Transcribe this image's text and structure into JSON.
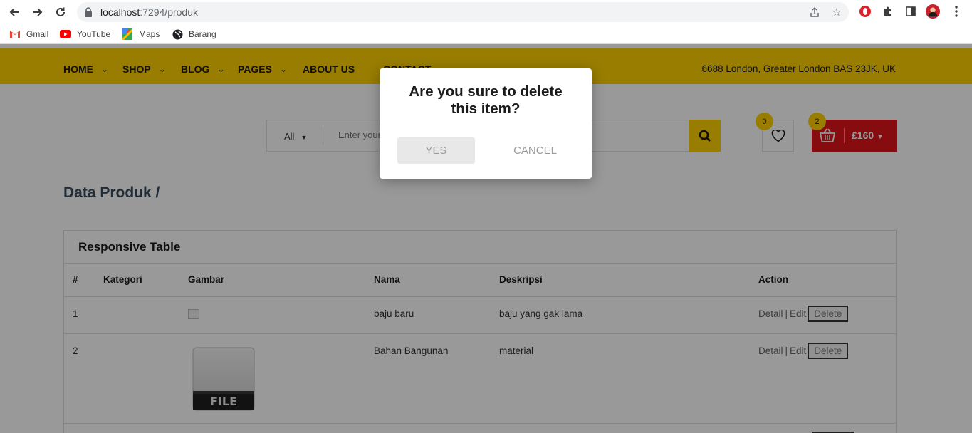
{
  "browser": {
    "url_host": "localhost",
    "url_path": ":7294/produk",
    "bookmarks": [
      {
        "label": "Gmail",
        "icon": "gmail-icon"
      },
      {
        "label": "YouTube",
        "icon": "youtube-icon"
      },
      {
        "label": "Maps",
        "icon": "maps-icon"
      },
      {
        "label": "Barang",
        "icon": "globe-icon"
      }
    ]
  },
  "header": {
    "menu": [
      {
        "label": "HOME",
        "has_dropdown": true
      },
      {
        "label": "SHOP",
        "has_dropdown": true
      },
      {
        "label": "BLOG",
        "has_dropdown": true
      },
      {
        "label": "PAGES",
        "has_dropdown": true
      },
      {
        "label": "ABOUT US",
        "has_dropdown": false
      },
      {
        "label": "CONTACT",
        "has_dropdown": false
      }
    ],
    "address": "6688 London, Greater London BAS 23JK, UK",
    "accent_color": "#fdd100"
  },
  "search": {
    "category": "All",
    "placeholder": "Enter your keyword..."
  },
  "wishlist": {
    "count": "0"
  },
  "cart": {
    "count": "2",
    "total": "£160",
    "color": "#e1141b"
  },
  "page": {
    "title": "Data Produk /"
  },
  "table": {
    "title": "Responsive Table",
    "columns": [
      "#",
      "Kategori",
      "Gambar",
      "Nama",
      "Deskripsi",
      "Action"
    ],
    "rows": [
      {
        "no": "1",
        "kategori": "",
        "nama": "baju baru",
        "deskripsi": "baju yang gak lama",
        "image": "broken-image-icon"
      },
      {
        "no": "2",
        "kategori": "",
        "nama": "Bahan Bangunan",
        "deskripsi": "material",
        "image": "file-icon",
        "image_text": "FILE"
      }
    ],
    "actions": {
      "detail": "Detail",
      "sep": "|",
      "edit": "Edit",
      "delete": "Delete"
    }
  },
  "dialog": {
    "title": "Are you sure to delete this item?",
    "yes": "YES",
    "cancel": "CANCEL"
  }
}
